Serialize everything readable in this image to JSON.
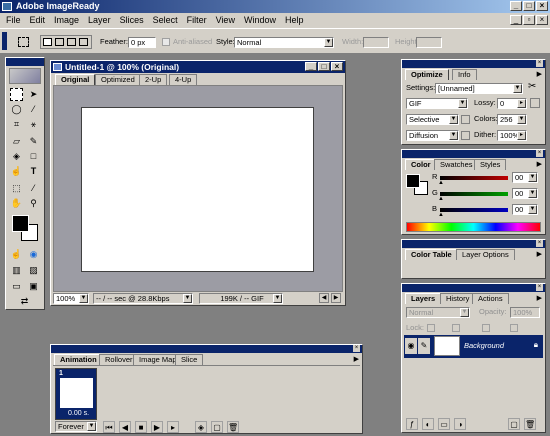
{
  "app": {
    "title": "Adobe ImageReady"
  },
  "menu": [
    "File",
    "Edit",
    "Image",
    "Layer",
    "Slices",
    "Select",
    "Filter",
    "View",
    "Window",
    "Help"
  ],
  "options": {
    "feather_label": "Feather:",
    "feather_value": "0 px",
    "antialiased": "Anti-aliased",
    "style_label": "Style:",
    "style_value": "Normal",
    "width_label": "Width:",
    "height_label": "Height:"
  },
  "document": {
    "title": "Untitled-1 @ 100% (Original)",
    "tabs": [
      "Original",
      "Optimized",
      "2-Up",
      "4-Up"
    ],
    "status": {
      "zoom": "100%",
      "download": "-- / -- sec @ 28.8Kbps",
      "size": "199K / -- GIF"
    }
  },
  "optimize_panel": {
    "tabs": [
      "Optimize",
      "Info"
    ],
    "settings_label": "Settings:",
    "settings_value": "[Unnamed]",
    "format": "GIF",
    "lossy_label": "Lossy:",
    "lossy_value": "0",
    "palette": "Selective",
    "colors_label": "Colors:",
    "colors_value": "256",
    "dither_type": "Diffusion",
    "dither_label": "Dither:",
    "dither_value": "100%"
  },
  "color_panel": {
    "tabs": [
      "Color",
      "Swatches",
      "Styles"
    ],
    "channels": [
      {
        "label": "R",
        "value": "00",
        "color": "#c00000"
      },
      {
        "label": "G",
        "value": "00",
        "color": "#00a000"
      },
      {
        "label": "B",
        "value": "00",
        "color": "#0000c0"
      }
    ]
  },
  "colortable_panel": {
    "tabs": [
      "Color Table",
      "Layer Options"
    ]
  },
  "layers_panel": {
    "tabs": [
      "Layers",
      "History",
      "Actions"
    ],
    "blend": "Normal",
    "opacity_label": "Opacity:",
    "opacity_value": "100%",
    "lock_label": "Lock:",
    "layer_name": "Background"
  },
  "animation_panel": {
    "tabs": [
      "Animation",
      "Rollover",
      "Image Map",
      "Slice"
    ],
    "frame_number": "1",
    "frame_delay": "0.00 s.",
    "loop": "Forever"
  },
  "colors": {
    "title_bar": "#0a246a",
    "selection": "#0a246a"
  }
}
